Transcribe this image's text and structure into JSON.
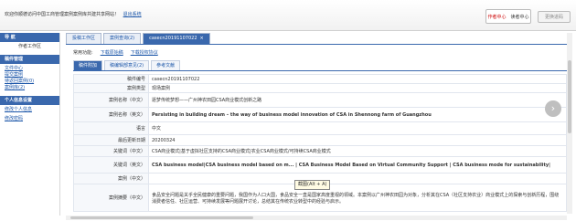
{
  "topbar": {
    "welcome_text": "欢迎你顺德访问中国工商管理案例案例库共建共享网站！",
    "logout_label": "退出系统",
    "user_current": "作者中心",
    "user_other": "读者中心",
    "change_password": "更换进码"
  },
  "sidebar": {
    "section1": "导 航",
    "workspace": "作者工作区",
    "section2": "稿件管理",
    "items": [
      "文件中心",
      "提交案例",
      "待返回案例(0)",
      "案例库(2)"
    ],
    "section3": "个人信息设置",
    "settings": [
      "修改个人信息",
      "修改密码"
    ]
  },
  "tabs": [
    {
      "label": "投稿工作区"
    },
    {
      "label": "案例查询(2)"
    },
    {
      "label": "casecn20191107022",
      "close": "×"
    }
  ],
  "sublinks": {
    "prefix": "常用功能:",
    "download": "下载原始稿",
    "agreement": "下载授权协议"
  },
  "inner_tabs": [
    "稿件附加",
    "稿编辑部意见(2)",
    "参考文献"
  ],
  "detail": {
    "rows": [
      {
        "label": "稿件编号",
        "value": "casecn20191107022"
      },
      {
        "label": "案例类型",
        "value": "现场案例"
      },
      {
        "label": "案例名称（中文）",
        "value": "逐梦传统梦想——广州神农田园CSA商业模式创新之路"
      },
      {
        "label": "案例名称（英文）",
        "value": "Persisting in building dream – the way of business model innovation of CSA in Shennong farm of Guangzhou"
      },
      {
        "label": "语言",
        "value": "中文"
      },
      {
        "label": "最后更新日期",
        "value": "20200324"
      },
      {
        "label": "关键词（中文）",
        "value": "CSA商业模式|基于虚拟社区支持的CSA商业模式|农业CSA商业模式/可持续CSA商业模式"
      },
      {
        "label": "关键词（英文）",
        "value": "CSA business model|CSA business model based on m... | CSA Business Model Based on Virtual Community Support | CSA business mode for sustainability|"
      },
      {
        "label": "案例（中文）",
        "value": ""
      },
      {
        "label": "案例摘要（中文）",
        "value": "食品安全问题是关乎全民健康的重要问题，我国作为人口大国，食品安全一直是国家高度重视的领域。本案例以广州神农田园为对象，分析其在CSA（社区支持农业）商业模式上的探索与创新历程，围绕消费者信任、社区运营、可持续发展等问题展开讨论，总结其在传统农业转型中的经验与启示。"
      }
    ]
  },
  "tooltip": "截图(Alt + A)"
}
